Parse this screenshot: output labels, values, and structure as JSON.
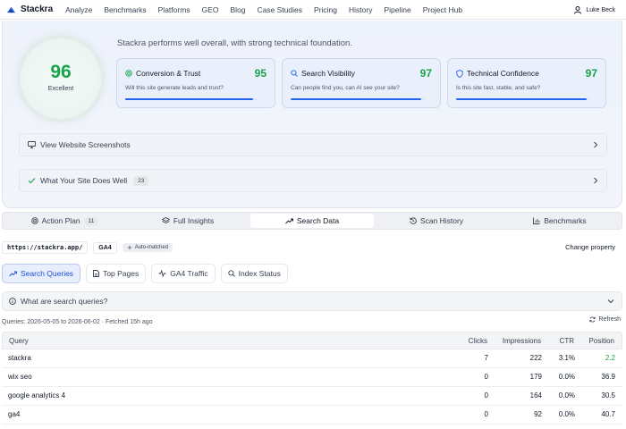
{
  "nav": {
    "brand": "Stackra",
    "links": [
      "Analyze",
      "Benchmarks",
      "Platforms",
      "GEO",
      "Blog",
      "Case Studies",
      "Pricing",
      "History",
      "Pipeline",
      "Project Hub"
    ],
    "user": "Luke Beck"
  },
  "hero": {
    "score": "96",
    "score_label": "Excellent",
    "summary": "Stackra performs well overall, with strong technical foundation.",
    "cards": [
      {
        "title": "Conversion & Trust",
        "score": "95",
        "desc": "Will this site generate leads and trust?",
        "progress": 0.95,
        "icon": "target-icon"
      },
      {
        "title": "Search Visibility",
        "score": "97",
        "desc": "Can people find you, can AI see your site?",
        "progress": 0.97,
        "icon": "search-icon"
      },
      {
        "title": "Technical Confidence",
        "score": "97",
        "desc": "Is this site fast, stable, and safe?",
        "progress": 0.97,
        "icon": "shield-icon"
      }
    ],
    "screenshots_label": "View Website Screenshots",
    "does_well_label": "What Your Site Does Well",
    "does_well_count": "23"
  },
  "tabs": [
    {
      "label": "Action Plan",
      "count": "11",
      "icon": "target-icon",
      "active": false
    },
    {
      "label": "Full Insights",
      "count": "",
      "icon": "layers-icon",
      "active": false
    },
    {
      "label": "Search Data",
      "count": "",
      "icon": "trending-up-icon",
      "active": true
    },
    {
      "label": "Scan History",
      "count": "",
      "icon": "history-icon",
      "active": false
    },
    {
      "label": "Benchmarks",
      "count": "",
      "icon": "bar-chart-icon",
      "active": false
    }
  ],
  "property": {
    "url": "https://stackra.app/",
    "ga": "GA4",
    "auto": "Auto-matched",
    "change": "Change property"
  },
  "subtabs": [
    {
      "label": "Search Queries",
      "icon": "trending-up-icon",
      "active": true
    },
    {
      "label": "Top Pages",
      "icon": "file-icon",
      "active": false
    },
    {
      "label": "GA4 Traffic",
      "icon": "activity-icon",
      "active": false
    },
    {
      "label": "Index Status",
      "icon": "search-icon",
      "active": false
    }
  ],
  "whatare": "What are search queries?",
  "meta": "Queries: 2026-05-05 to 2026-06-02 · Fetched 15h ago",
  "refresh": "Refresh",
  "table": {
    "headers": {
      "query": "Query",
      "clicks": "Clicks",
      "impressions": "Impressions",
      "ctr": "CTR",
      "position": "Position"
    },
    "rows": [
      {
        "query": "stackra",
        "clicks": "7",
        "impressions": "222",
        "ctr": "3.1%",
        "position": "2.2"
      },
      {
        "query": "wix seo",
        "clicks": "0",
        "impressions": "179",
        "ctr": "0.0%",
        "position": "36.9"
      },
      {
        "query": "google analytics 4",
        "clicks": "0",
        "impressions": "164",
        "ctr": "0.0%",
        "position": "30.5"
      },
      {
        "query": "ga4",
        "clicks": "0",
        "impressions": "92",
        "ctr": "0.0%",
        "position": "40.7"
      }
    ]
  },
  "colors": {
    "accent": "#2563eb",
    "good": "#16a34a"
  }
}
